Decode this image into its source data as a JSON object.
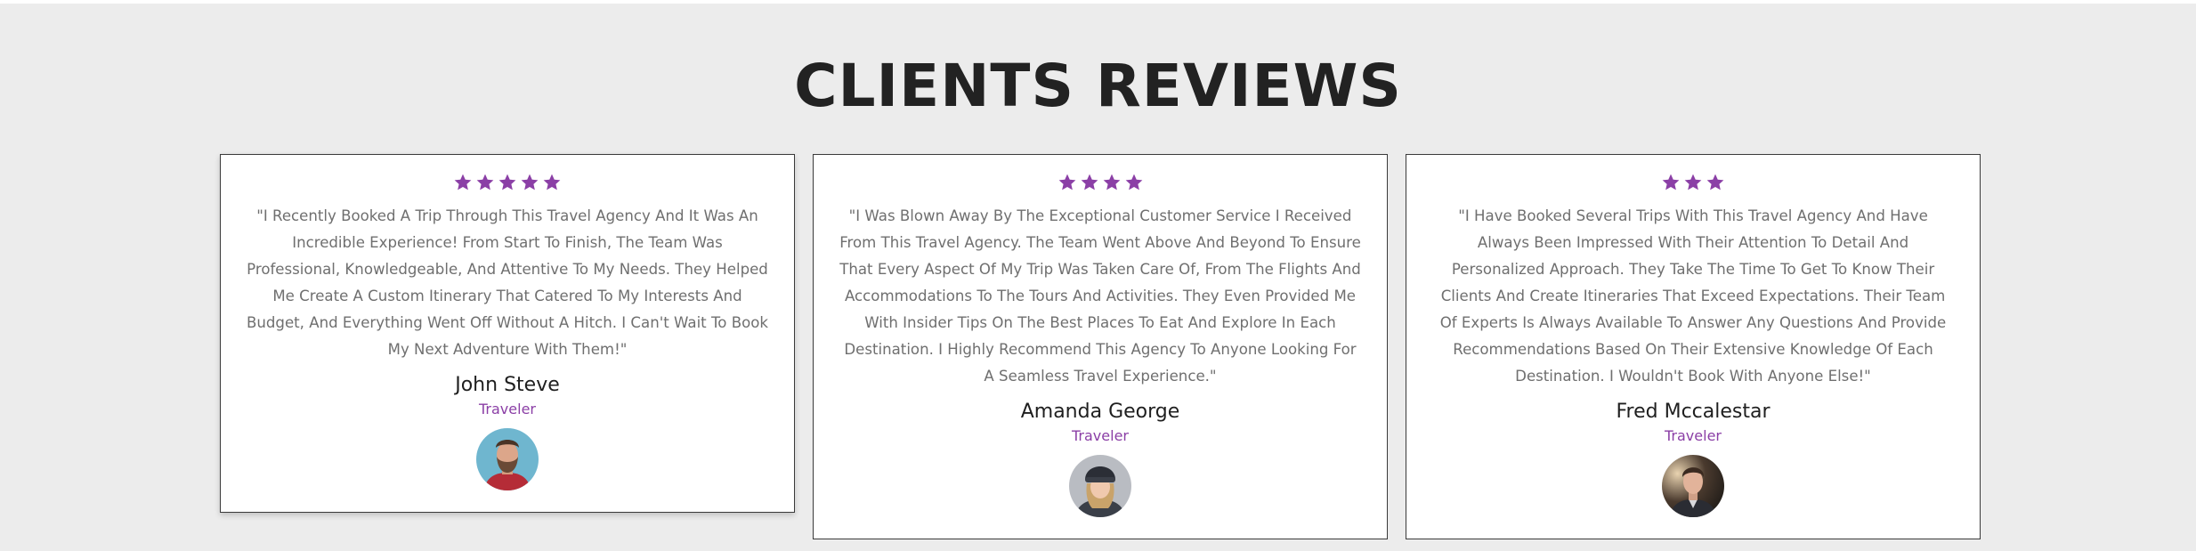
{
  "section": {
    "title": "CLIENTS REVIEWS"
  },
  "colors": {
    "accent": "#8b3fa6",
    "star": "#8b3fa6",
    "background": "#ececec",
    "card": "#ffffff"
  },
  "reviews": [
    {
      "rating": 5,
      "quote": "\"I Recently Booked A Trip Through This Travel Agency And It Was An Incredible Experience! From Start To Finish, The Team Was Professional, Knowledgeable, And Attentive To My Needs. They Helped Me Create A Custom Itinerary That Catered To My Interests And Budget, And Everything Went Off Without A Hitch. I Can't Wait To Book My Next Adventure With Them!\"",
      "name": "John Steve",
      "role": "Traveler",
      "avatar_icon": "bearded-man-avatar"
    },
    {
      "rating": 4,
      "quote": "\"I Was Blown Away By The Exceptional Customer Service I Received From This Travel Agency. The Team Went Above And Beyond To Ensure That Every Aspect Of My Trip Was Taken Care Of, From The Flights And Accommodations To The Tours And Activities. They Even Provided Me With Insider Tips On The Best Places To Eat And Explore In Each Destination. I Highly Recommend This Agency To Anyone Looking For A Seamless Travel Experience.\"",
      "name": "Amanda George",
      "role": "Traveler",
      "avatar_icon": "woman-beanie-avatar"
    },
    {
      "rating": 3,
      "quote": "\"I Have Booked Several Trips With This Travel Agency And Have Always Been Impressed With Their Attention To Detail And Personalized Approach. They Take The Time To Get To Know Their Clients And Create Itineraries That Exceed Expectations. Their Team Of Experts Is Always Available To Answer Any Questions And Provide Recommendations Based On Their Extensive Knowledge Of Each Destination. I Wouldn't Book With Anyone Else!\"",
      "name": "Fred Mccalestar",
      "role": "Traveler",
      "avatar_icon": "man-portrait-avatar"
    }
  ]
}
